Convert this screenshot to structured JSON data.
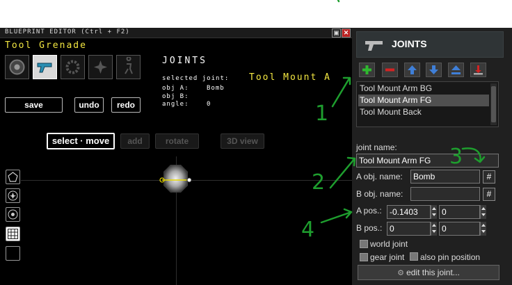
{
  "window": {
    "title": "BLUEPRINT EDITOR (Ctrl + F2)",
    "restore_icon": "restore-icon",
    "close_label": "✕"
  },
  "editor": {
    "object_title": "Tool Grenade",
    "tools": [
      "eye-icon",
      "gun-icon",
      "gear-icon",
      "star-icon",
      "figure-icon"
    ],
    "joints_heading": "JOINTS",
    "selected_joint_label": "selected joint:",
    "selected_joint_value": "Tool Mount A",
    "obj_a_label": "obj A:",
    "obj_a_value": "Bomb",
    "obj_b_label": "obj B:",
    "obj_b_value": "",
    "angle_label": "angle:",
    "angle_value": "0",
    "save_label": "save",
    "undo_label": "undo",
    "redo_label": "redo",
    "select_move_label": "select · move",
    "add_label": "add",
    "rotate_label": "rotate",
    "view3d_label": "3D view"
  },
  "panel": {
    "title": "JOINTS",
    "toolbar": [
      "add-joint-icon",
      "remove-joint-icon",
      "move-up-icon",
      "move-down-icon",
      "move-top-icon",
      "move-bottom-icon"
    ],
    "joints": [
      "Tool Mount Arm BG",
      "Tool Mount Arm FG",
      "Tool Mount Back"
    ],
    "selected_index": 1,
    "joint_name_label": "joint name:",
    "joint_name_value": "Tool Mount Arm FG",
    "a_obj_label": "A obj. name:",
    "a_obj_value": "Bomb",
    "b_obj_label": "B obj. name:",
    "b_obj_value": "",
    "hash_label": "#",
    "a_pos_label": "A pos.:",
    "a_pos_x": "-0.1403",
    "a_pos_y": "0",
    "b_pos_label": "B pos.:",
    "b_pos_x": "0",
    "b_pos_y": "0",
    "world_joint_label": "world joint",
    "gear_joint_label": "gear joint",
    "pin_position_label": "also pin position",
    "edit_label": "edit this joint..."
  },
  "annotations": [
    "1",
    "2",
    "3",
    "4"
  ],
  "colors": {
    "accent_yellow": "#f4e842",
    "annotation_green": "#1e9e2e"
  }
}
